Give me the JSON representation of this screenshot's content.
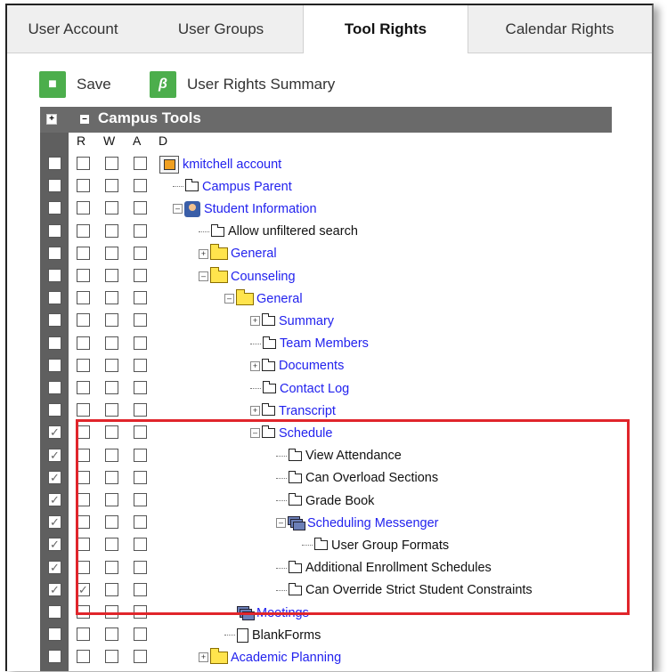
{
  "tabs": [
    {
      "label": "User Account",
      "active": false
    },
    {
      "label": "User Groups",
      "active": false
    },
    {
      "label": "Tool Rights",
      "active": true
    },
    {
      "label": "Calendar Rights",
      "active": false
    }
  ],
  "toolbar": {
    "save_label": "Save",
    "summary_label": "User Rights Summary",
    "save_icon": "floppy-icon",
    "summary_icon": "user-rights-icon",
    "accent": "#4cae4c"
  },
  "tree": {
    "header": "Campus Tools",
    "columns": [
      "R",
      "W",
      "A",
      "D"
    ],
    "rows": [
      {
        "label": "kmitchell account",
        "icon": "account",
        "indent": 0,
        "expander": "",
        "link": true,
        "checks": [
          false,
          false,
          false,
          false
        ]
      },
      {
        "label": "Campus Parent",
        "icon": "file",
        "indent": 1,
        "expander": "",
        "link": true,
        "checks": [
          false,
          false,
          false,
          false
        ]
      },
      {
        "label": "Student Information",
        "icon": "person",
        "indent": 1,
        "expander": "-",
        "link": true,
        "checks": [
          false,
          false,
          false,
          false
        ]
      },
      {
        "label": "Allow unfiltered search",
        "icon": "file",
        "indent": 2,
        "expander": "",
        "link": false,
        "checks": [
          false,
          false,
          false,
          false
        ]
      },
      {
        "label": "General",
        "icon": "folder",
        "indent": 2,
        "expander": "+",
        "link": true,
        "checks": [
          false,
          false,
          false,
          false
        ]
      },
      {
        "label": "Counseling",
        "icon": "folder",
        "indent": 2,
        "expander": "-",
        "link": true,
        "checks": [
          false,
          false,
          false,
          false
        ]
      },
      {
        "label": "General",
        "icon": "folder",
        "indent": 3,
        "expander": "-",
        "link": true,
        "checks": [
          false,
          false,
          false,
          false
        ]
      },
      {
        "label": "Summary",
        "icon": "file",
        "indent": 4,
        "expander": "+",
        "link": true,
        "checks": [
          false,
          false,
          false,
          false
        ]
      },
      {
        "label": "Team Members",
        "icon": "file",
        "indent": 4,
        "expander": "",
        "link": true,
        "checks": [
          false,
          false,
          false,
          false
        ]
      },
      {
        "label": "Documents",
        "icon": "file",
        "indent": 4,
        "expander": "+",
        "link": true,
        "checks": [
          false,
          false,
          false,
          false
        ]
      },
      {
        "label": "Contact Log",
        "icon": "file",
        "indent": 4,
        "expander": "",
        "link": true,
        "checks": [
          false,
          false,
          false,
          false
        ]
      },
      {
        "label": "Transcript",
        "icon": "file",
        "indent": 4,
        "expander": "+",
        "link": true,
        "checks": [
          false,
          false,
          false,
          false
        ]
      },
      {
        "label": "Schedule",
        "icon": "file",
        "indent": 4,
        "expander": "-",
        "link": true,
        "checks": [
          true,
          false,
          false,
          false
        ]
      },
      {
        "label": "View Attendance",
        "icon": "file",
        "indent": 5,
        "expander": "",
        "link": false,
        "checks": [
          true,
          false,
          false,
          false
        ]
      },
      {
        "label": "Can Overload Sections",
        "icon": "file",
        "indent": 5,
        "expander": "",
        "link": false,
        "checks": [
          true,
          false,
          false,
          false
        ]
      },
      {
        "label": "Grade Book",
        "icon": "file",
        "indent": 5,
        "expander": "",
        "link": false,
        "checks": [
          true,
          false,
          false,
          false
        ]
      },
      {
        "label": "Scheduling Messenger",
        "icon": "stack",
        "indent": 5,
        "expander": "-",
        "link": true,
        "checks": [
          true,
          false,
          false,
          false
        ]
      },
      {
        "label": "User Group Formats",
        "icon": "file",
        "indent": 6,
        "expander": "",
        "link": false,
        "checks": [
          true,
          false,
          false,
          false
        ]
      },
      {
        "label": "Additional Enrollment Schedules",
        "icon": "file",
        "indent": 5,
        "expander": "",
        "link": false,
        "checks": [
          true,
          false,
          false,
          false
        ]
      },
      {
        "label": "Can Override Strict Student Constraints",
        "icon": "file",
        "indent": 5,
        "expander": "",
        "link": false,
        "checks": [
          true,
          true,
          false,
          false
        ]
      },
      {
        "label": "Meetings",
        "icon": "stack",
        "indent": 3,
        "expander": "",
        "link": true,
        "checks": [
          false,
          false,
          false,
          false
        ]
      },
      {
        "label": "BlankForms",
        "icon": "page",
        "indent": 3,
        "expander": "",
        "link": false,
        "checks": [
          false,
          false,
          false,
          false
        ]
      },
      {
        "label": "Academic Planning",
        "icon": "folder",
        "indent": 2,
        "expander": "+",
        "link": true,
        "checks": [
          false,
          false,
          false,
          false
        ]
      }
    ]
  },
  "highlight_color": "#e0252b"
}
